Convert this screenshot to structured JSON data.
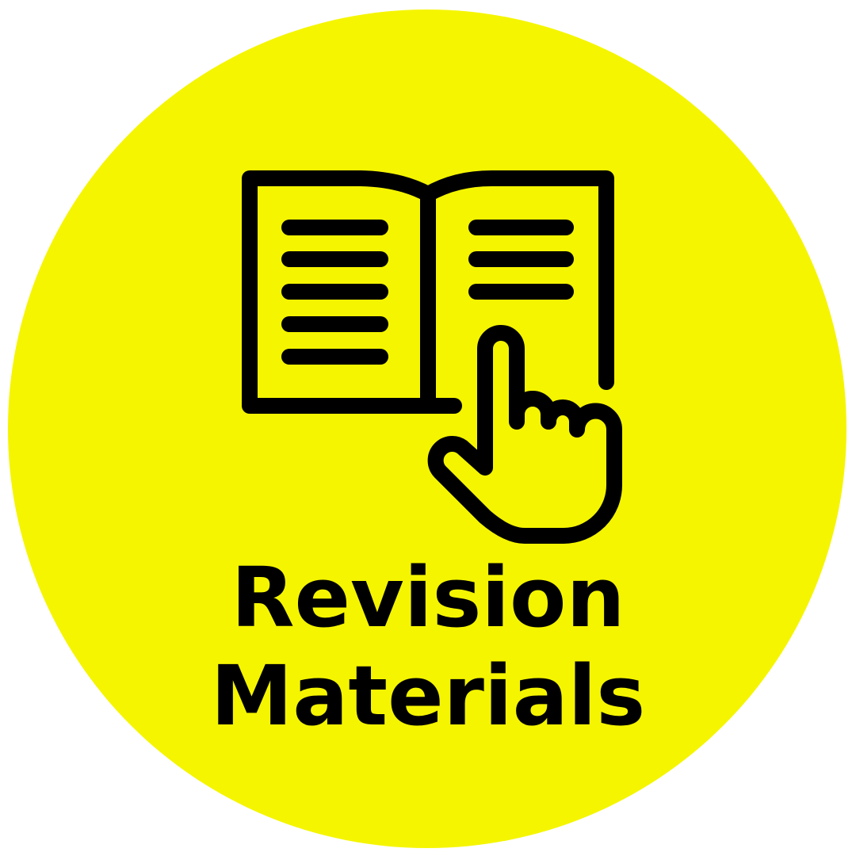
{
  "badge": {
    "title_line1": "Revision",
    "title_line2": "Materials",
    "icon": "book-with-pointing-hand-icon",
    "colors": {
      "background": "#f5f500",
      "foreground": "#000000"
    }
  }
}
